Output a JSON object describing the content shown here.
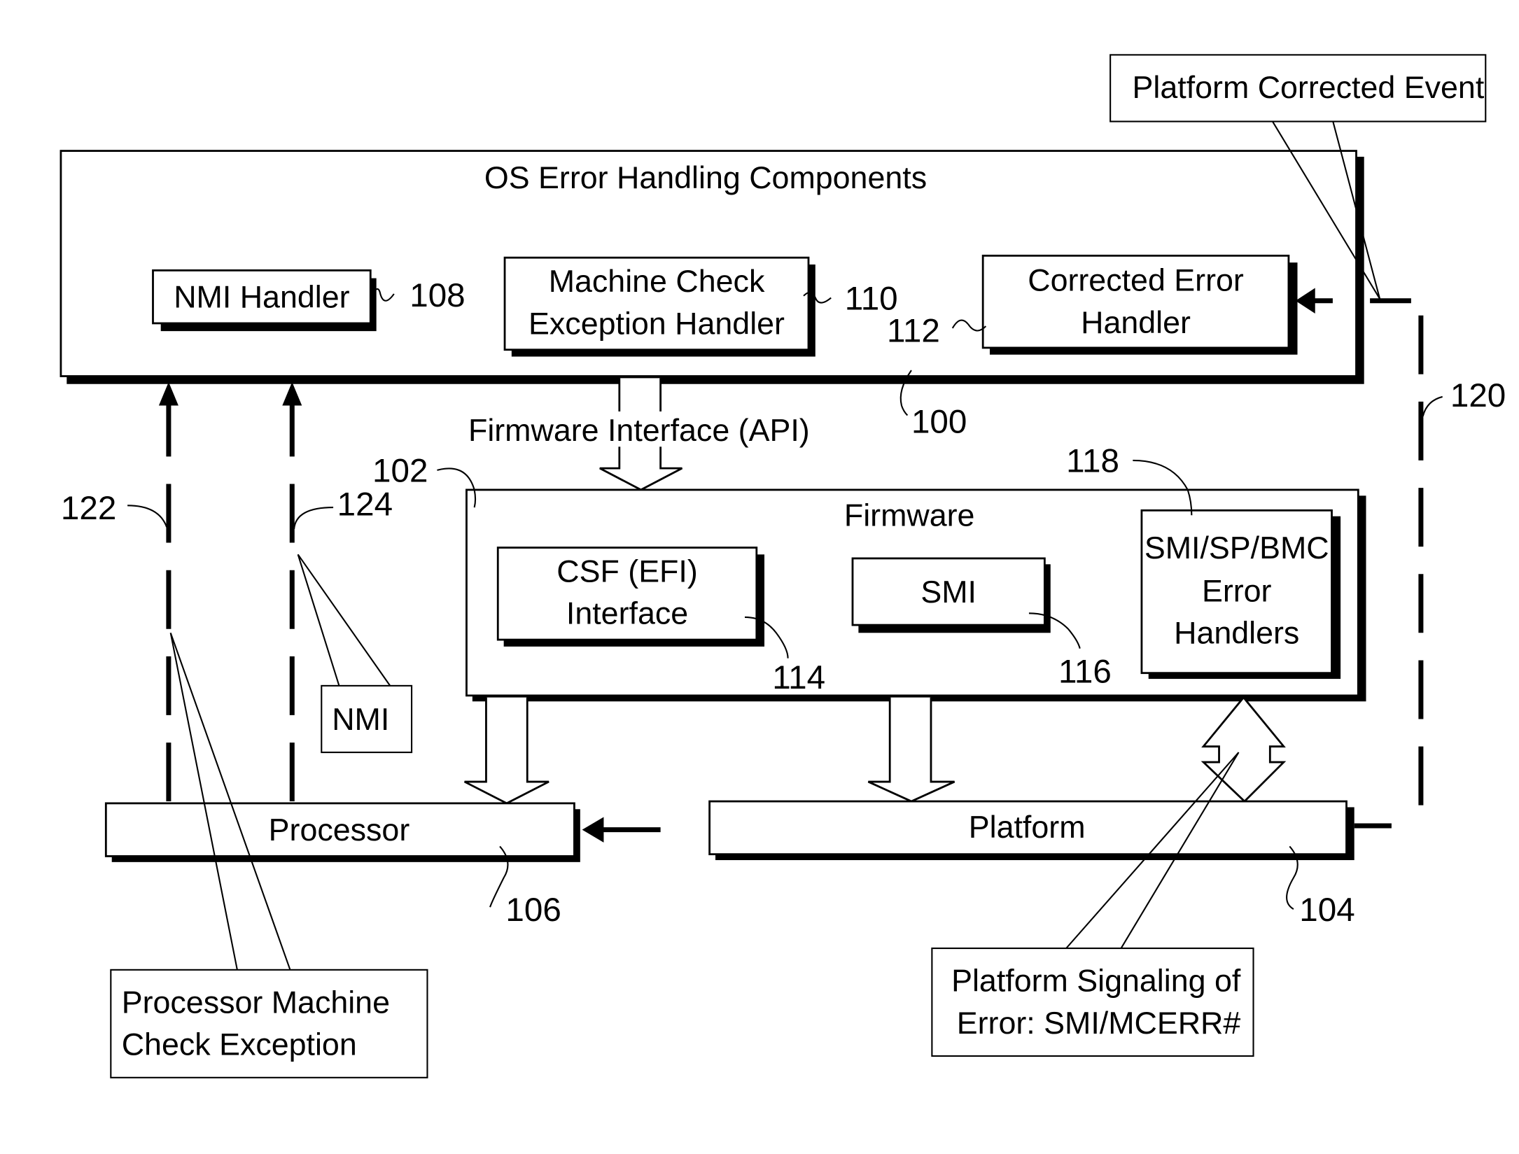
{
  "diagram": {
    "os_box": {
      "title": "OS Error Handling Components",
      "ref": "100"
    },
    "nmi_handler": {
      "label": "NMI Handler",
      "ref": "108"
    },
    "mce_handler": {
      "line1": "Machine Check",
      "line2": "Exception Handler",
      "ref": "110"
    },
    "ce_handler": {
      "line1": "Corrected Error",
      "line2": "Handler",
      "ref": "112"
    },
    "api_label": "Firmware Interface (API)",
    "firmware_box": {
      "title": "Firmware",
      "ref": "102"
    },
    "csf": {
      "line1": "CSF (EFI)",
      "line2": "Interface",
      "ref": "114"
    },
    "smi": {
      "label": "SMI",
      "ref": "116"
    },
    "smi_sp_bmc": {
      "line1": "SMI/SP/BMC",
      "line2": "Error",
      "line3": "Handlers",
      "ref": "118"
    },
    "processor": {
      "label": "Processor",
      "ref": "106"
    },
    "platform": {
      "label": "Platform",
      "ref": "104"
    },
    "signals": {
      "ref_120": "120",
      "ref_122": "122",
      "ref_124": "124"
    },
    "callouts": {
      "pce": "Platform Corrected Event",
      "nmi": "NMI",
      "pmce_line1": "Processor Machine",
      "pmce_line2": "Check Exception",
      "psig_line1": "Platform Signaling of",
      "psig_line2": "Error:  SMI/MCERR#"
    }
  }
}
